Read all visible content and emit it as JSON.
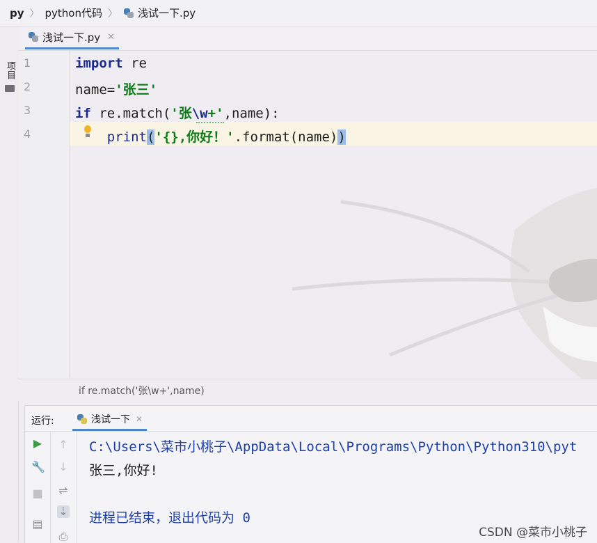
{
  "breadcrumb": {
    "root": "py",
    "folder": "python代码",
    "file": "浅试一下.py"
  },
  "left_strip": {
    "project_label": "项目"
  },
  "editor": {
    "tab_label": "浅试一下.py",
    "line_numbers": [
      "1",
      "2",
      "3",
      "4"
    ],
    "lines": {
      "l1_kw": "import",
      "l1_rest": " re",
      "l2_a": "name=",
      "l2_str": "'张三'",
      "l3_kw": "if",
      "l3_a": " re.match(",
      "l3_str1": "'张",
      "l3_esc": "\\w",
      "l3_str2": "+'",
      "l3_b": ",name):",
      "l4_indent": "    ",
      "l4_a": "print",
      "l4_paren_open": "(",
      "l4_str": "'{},你好！'",
      "l4_b": ".format(name)",
      "l4_paren_close": ")"
    },
    "status_crumb": "if re.match('张\\w+',name)"
  },
  "run": {
    "label": "运行:",
    "tab_label": "浅试一下",
    "output_path": "C:\\Users\\菜市小桃子\\AppData\\Local\\Programs\\Python\\Python310\\pyt",
    "output_result": "张三,你好!",
    "output_exit": "进程已结束，退出代码为 0",
    "tools_left": [
      "play-icon",
      "wrench-icon",
      "stop-icon",
      "layout-icon"
    ],
    "tools_right": [
      "arrow-up-icon",
      "arrow-down-icon",
      "soft-wrap-icon",
      "scroll-to-end-icon",
      "print-icon"
    ]
  },
  "watermark": "CSDN @菜市小桃子",
  "colors": {
    "accent": "#4d87c7",
    "keyword": "#1b2a8a",
    "string": "#0b7c18",
    "output": "#1d3fa8",
    "current_line": "#f9f4e4"
  }
}
